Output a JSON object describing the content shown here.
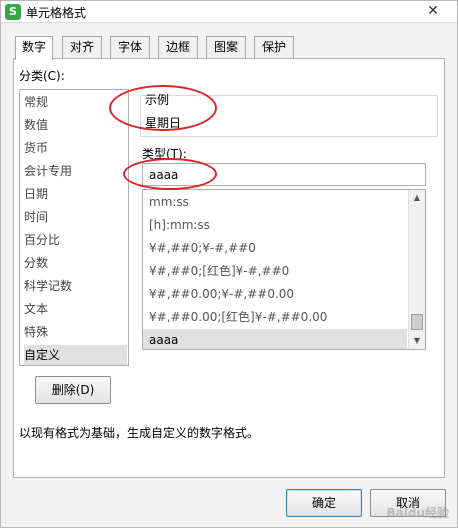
{
  "window": {
    "title": "单元格格式",
    "app_icon_text": "S",
    "close_symbol": "✕"
  },
  "tabs": [
    "数字",
    "对齐",
    "字体",
    "边框",
    "图案",
    "保护"
  ],
  "active_tab": "数字",
  "category": {
    "label": "分类(C):",
    "items": [
      "常规",
      "数值",
      "货币",
      "会计专用",
      "日期",
      "时间",
      "百分比",
      "分数",
      "科学记数",
      "文本",
      "特殊",
      "自定义"
    ],
    "selected": "自定义"
  },
  "sample": {
    "label": "示例",
    "value": "星期日"
  },
  "type": {
    "label": "类型(T):",
    "value": "aaaa",
    "formats": [
      "mm:ss",
      "[h]:mm:ss",
      "¥#,##0;¥-#,##0",
      "¥#,##0;[红色]¥-#,##0",
      "¥#,##0.00;¥-#,##0.00",
      "¥#,##0.00;[红色]¥-#,##0.00",
      "aaaa"
    ],
    "selected": "aaaa"
  },
  "delete_button": "删除(D)",
  "description": "以现有格式为基础，生成自定义的数字格式。",
  "ok_button": "确定",
  "cancel_button": "取消",
  "watermark": "Baidu经验",
  "colors": {
    "annotation": "#d8262a",
    "selection": "#e0e0e0",
    "app_icon": "#3aa44a"
  }
}
